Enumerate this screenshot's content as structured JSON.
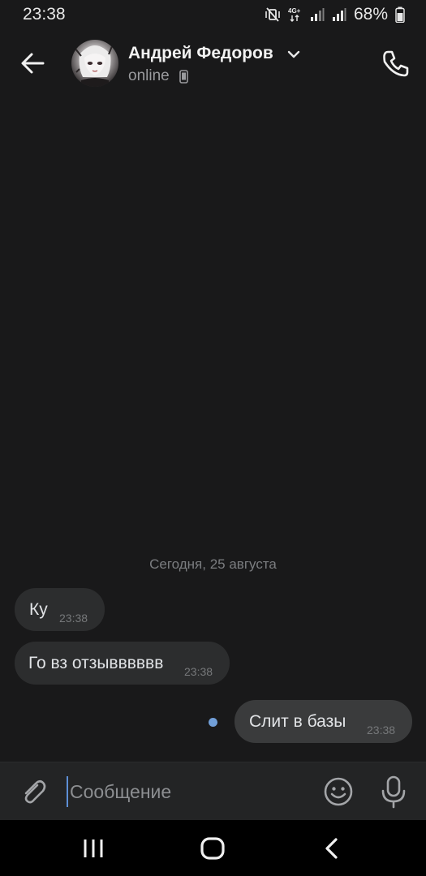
{
  "status_bar": {
    "time": "23:38",
    "network": "4G+",
    "battery": "68%",
    "icons": [
      "mute-vibrate-icon",
      "network-4g-icon",
      "signal-icon",
      "signal-icon",
      "battery-icon"
    ]
  },
  "header": {
    "contact_name": "Андрей Федоров",
    "status": "online",
    "icons": [
      "back-arrow-icon",
      "chevron-down-icon",
      "mobile-device-icon",
      "phone-icon"
    ]
  },
  "chat": {
    "date_separator": "Сегодня, 25 августа",
    "messages": [
      {
        "direction": "incoming",
        "text": "Ку",
        "time": "23:38"
      },
      {
        "direction": "incoming",
        "text": "Го вз отзывввввв",
        "time": "23:38"
      },
      {
        "direction": "outgoing",
        "text": "Слит в базы",
        "time": "23:38",
        "unread": true
      }
    ]
  },
  "composer": {
    "placeholder": "Сообщение",
    "value": "",
    "icons": [
      "paperclip-icon",
      "emoji-icon",
      "microphone-icon"
    ]
  },
  "nav_bar": {
    "icons": [
      "recent-apps-icon",
      "home-icon",
      "back-icon"
    ]
  },
  "colors": {
    "background": "#19191a",
    "bubble_incoming": "#2c2d2e",
    "bubble_outgoing": "#3a3b3c",
    "accent": "#719fd8",
    "composer_bg": "#232425"
  }
}
